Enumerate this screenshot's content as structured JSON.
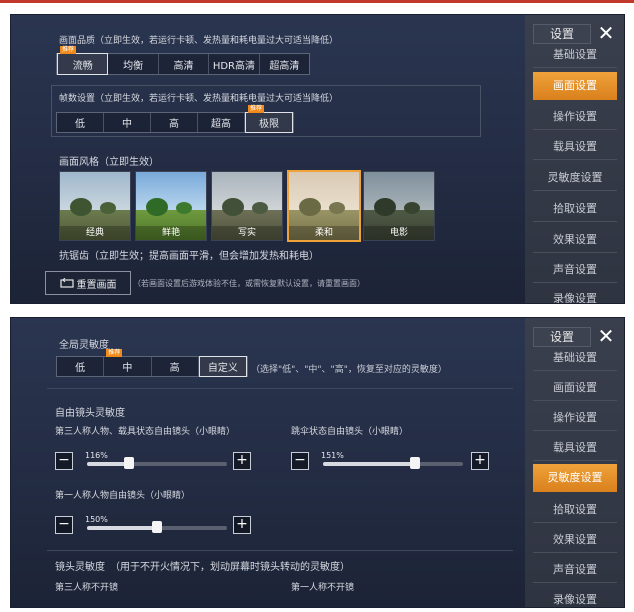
{
  "colors": {
    "accent": "#f0a23a",
    "panel": "#232c43",
    "top_rule": "#c0392b"
  },
  "panel1": {
    "quality": {
      "label": "画面品质（立即生效，若运行卡顿、发热量和耗电量过大可适当降低）",
      "badge": "推荐",
      "options": [
        "流畅",
        "均衡",
        "高清",
        "HDR高清",
        "超高清"
      ],
      "selected": "流畅"
    },
    "fps": {
      "label": "帧数设置（立即生效，若运行卡顿、发热量和耗电量过大可适当降低）",
      "badge": "推荐",
      "options": [
        "低",
        "中",
        "高",
        "超高",
        "极限"
      ],
      "selected": "极限"
    },
    "style": {
      "label": "画面风格（立即生效）",
      "badge": "推荐",
      "items": [
        "经典",
        "鲜艳",
        "写实",
        "柔和",
        "电影"
      ],
      "selected": "柔和"
    },
    "aa": {
      "label": "抗锯齿（立即生效；提高画面平滑，但会增加发热和耗电）"
    },
    "reset": {
      "label": "重置画面",
      "icon": "reset-icon",
      "note": "（若画面设置后游戏体验不佳，或需恢复默认设置，请重置画面）"
    },
    "sidebar": {
      "title": "设置",
      "close": "✕",
      "items": [
        "基础设置",
        "画面设置",
        "操作设置",
        "载具设置",
        "灵敏度设置",
        "拾取设置",
        "效果设置",
        "声音设置",
        "录像设置"
      ],
      "active": "画面设置"
    }
  },
  "panel2": {
    "global": {
      "label": "全局灵敏度",
      "badge": "推荐",
      "options": [
        "低",
        "中",
        "高",
        "自定义"
      ],
      "selected": "自定义",
      "hint": "（选择\"低\"、\"中\"、\"高\"，恢复至对应的灵敏度）"
    },
    "freelook": {
      "label": "自由镜头灵敏度",
      "third": {
        "label": "第三人称人物、载具状态自由镜头（小眼睛）",
        "value": "116%",
        "fraction": 0.3
      },
      "para": {
        "label": "跳伞状态自由镜头（小眼睛）",
        "value": "151%",
        "fraction": 0.66
      },
      "first": {
        "label": "第一人称人物自由镜头（小眼睛）",
        "value": "150%",
        "fraction": 0.5
      }
    },
    "lens": {
      "label": "镜头灵敏度　（用于不开火情况下，划动屏幕时镜头转动的灵敏度）",
      "third": "第三人称不开镜",
      "first": "第一人称不开镜"
    },
    "sidebar": {
      "title": "设置",
      "close": "✕",
      "items": [
        "基础设置",
        "画面设置",
        "操作设置",
        "载具设置",
        "灵敏度设置",
        "拾取设置",
        "效果设置",
        "声音设置",
        "录像设置"
      ],
      "active": "灵敏度设置"
    }
  }
}
